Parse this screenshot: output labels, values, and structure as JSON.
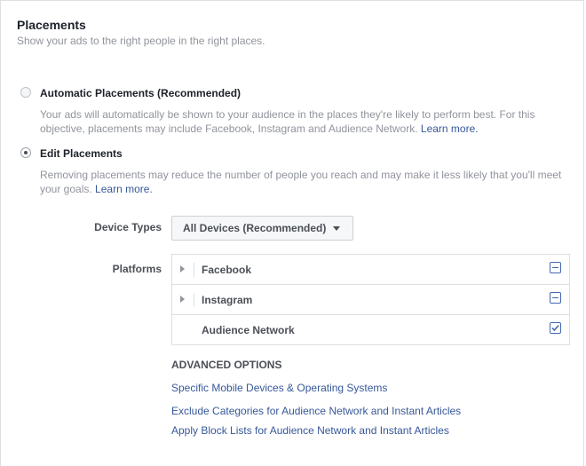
{
  "section": {
    "title": "Placements",
    "subtitle": "Show your ads to the right people in the right places."
  },
  "options": {
    "automatic": {
      "label": "Automatic Placements (Recommended)",
      "selected": false,
      "description": "Your ads will automatically be shown to your audience in the places they're likely to perform best. For this objective, placements may include Facebook, Instagram and Audience Network.",
      "link": "Learn more."
    },
    "edit": {
      "label": "Edit Placements",
      "selected": true,
      "description": "Removing placements may reduce the number of people you reach and may make it less likely that you'll meet your goals.",
      "link": "Learn more."
    }
  },
  "device_types": {
    "label": "Device Types",
    "value": "All Devices (Recommended)"
  },
  "platforms": {
    "label": "Platforms",
    "items": [
      {
        "label": "Facebook",
        "expandable": true,
        "checkbox": "partial"
      },
      {
        "label": "Instagram",
        "expandable": true,
        "checkbox": "partial"
      },
      {
        "label": "Audience Network",
        "expandable": false,
        "checkbox": "checked"
      }
    ]
  },
  "advanced": {
    "title": "ADVANCED OPTIONS",
    "links": [
      "Specific Mobile Devices & Operating Systems",
      "Exclude Categories for Audience Network and Instant Articles",
      "Apply Block Lists for Audience Network and Instant Articles"
    ]
  },
  "colors": {
    "link": "#365899",
    "checkbox": "#4267b2",
    "muted_text": "#90949c"
  }
}
